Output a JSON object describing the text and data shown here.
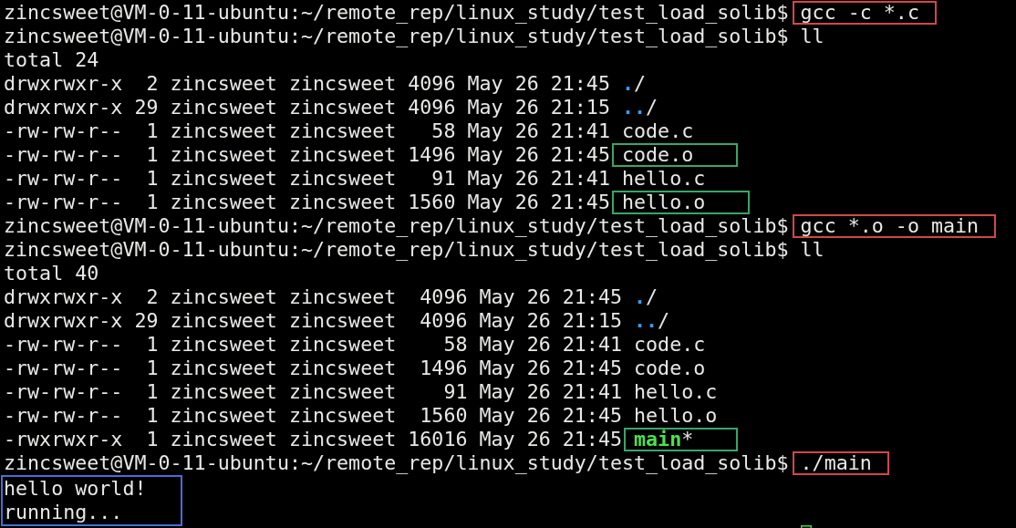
{
  "terminal": {
    "lines": [
      {
        "kind": "prompt",
        "prompt": "zincsweet@VM-0-11-ubuntu:~/remote_rep/linux_study/test_load_solib$",
        "command": "gcc -c *.c",
        "annotation": {
          "color": "#d04848"
        }
      },
      {
        "kind": "prompt",
        "prompt": "zincsweet@VM-0-11-ubuntu:~/remote_rep/linux_study/test_load_solib$",
        "command": "ll"
      },
      {
        "kind": "output",
        "text": "total 24"
      },
      {
        "kind": "listing",
        "details": "drwxrwxr-x  2 zincsweet zincsweet 4096 May 26 21:45",
        "file": {
          "kind": "directory",
          "name": ".",
          "suffix": "/"
        }
      },
      {
        "kind": "listing",
        "details": "drwxrwxr-x 29 zincsweet zincsweet 4096 May 26 21:15",
        "file": {
          "kind": "directory",
          "name": "..",
          "suffix": "/"
        }
      },
      {
        "kind": "listing",
        "details": "-rw-rw-r--  1 zincsweet zincsweet   58 May 26 21:41",
        "file": {
          "kind": "regular",
          "name": "code.c"
        }
      },
      {
        "kind": "listing",
        "details": "-rw-rw-r--  1 zincsweet zincsweet 1496 May 26 21:45",
        "file": {
          "kind": "regular",
          "name": "code.o"
        },
        "annotation": {
          "color": "#3aa568"
        }
      },
      {
        "kind": "listing",
        "details": "-rw-rw-r--  1 zincsweet zincsweet   91 May 26 21:41",
        "file": {
          "kind": "regular",
          "name": "hello.c"
        }
      },
      {
        "kind": "listing",
        "details": "-rw-rw-r--  1 zincsweet zincsweet 1560 May 26 21:45",
        "file": {
          "kind": "regular",
          "name": "hello.o"
        },
        "annotation": {
          "color": "#3aa568"
        }
      },
      {
        "kind": "prompt",
        "prompt": "zincsweet@VM-0-11-ubuntu:~/remote_rep/linux_study/test_load_solib$",
        "command": "gcc *.o -o main",
        "annotation": {
          "color": "#d04848"
        }
      },
      {
        "kind": "prompt",
        "prompt": "zincsweet@VM-0-11-ubuntu:~/remote_rep/linux_study/test_load_solib$",
        "command": "ll"
      },
      {
        "kind": "output",
        "text": "total 40"
      },
      {
        "kind": "listing",
        "details": "drwxrwxr-x  2 zincsweet zincsweet  4096 May 26 21:45",
        "file": {
          "kind": "directory",
          "name": ".",
          "suffix": "/"
        }
      },
      {
        "kind": "listing",
        "details": "drwxrwxr-x 29 zincsweet zincsweet  4096 May 26 21:15",
        "file": {
          "kind": "directory",
          "name": "..",
          "suffix": "/"
        }
      },
      {
        "kind": "listing",
        "details": "-rw-rw-r--  1 zincsweet zincsweet    58 May 26 21:41",
        "file": {
          "kind": "regular",
          "name": "code.c"
        }
      },
      {
        "kind": "listing",
        "details": "-rw-rw-r--  1 zincsweet zincsweet  1496 May 26 21:45",
        "file": {
          "kind": "regular",
          "name": "code.o"
        }
      },
      {
        "kind": "listing",
        "details": "-rw-rw-r--  1 zincsweet zincsweet    91 May 26 21:41",
        "file": {
          "kind": "regular",
          "name": "hello.c"
        }
      },
      {
        "kind": "listing",
        "details": "-rw-rw-r--  1 zincsweet zincsweet  1560 May 26 21:45",
        "file": {
          "kind": "regular",
          "name": "hello.o"
        }
      },
      {
        "kind": "listing",
        "details": "-rwxrwxr-x  1 zincsweet zincsweet 16016 May 26 21:45",
        "file": {
          "kind": "executable",
          "name": "main",
          "suffix": "*"
        },
        "annotation": {
          "color": "#3aa568"
        }
      },
      {
        "kind": "prompt",
        "prompt": "zincsweet@VM-0-11-ubuntu:~/remote_rep/linux_study/test_load_solib$",
        "command": "./main",
        "annotation": {
          "color": "#d04848"
        }
      },
      {
        "kind": "output_block",
        "lines": [
          "hello world!",
          "running..."
        ],
        "annotation": {
          "color": "#4a6cd4"
        }
      }
    ],
    "cursor": true
  }
}
